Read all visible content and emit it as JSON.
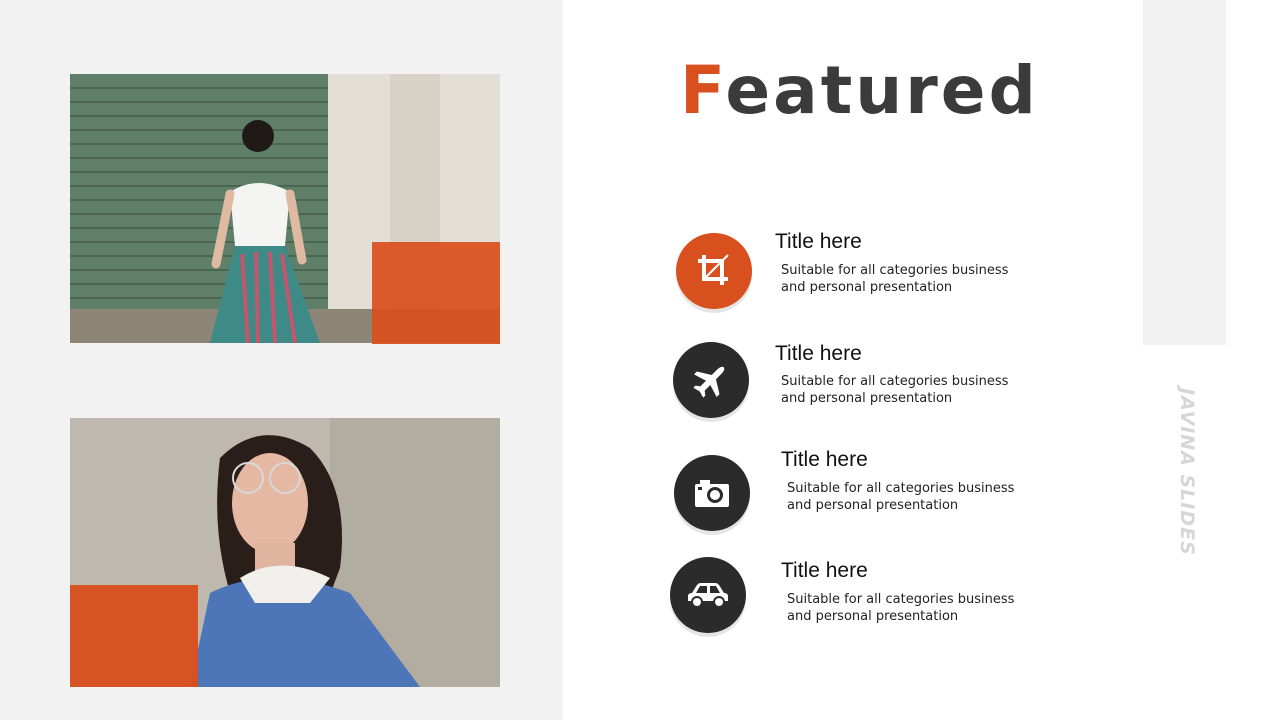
{
  "slide": {
    "heading_first": "F",
    "heading_rest": "eatured",
    "brand": "JAVINA SLIDES",
    "colors": {
      "accent": "#d9501f",
      "dark": "#2b2b2b",
      "panel": "#f2f2f2"
    }
  },
  "features": [
    {
      "icon": "crop-icon",
      "title": "Title here",
      "description": "Suitable for all categories business and personal presentation"
    },
    {
      "icon": "airplane-icon",
      "title": "Title here",
      "description": "Suitable for all categories business and personal presentation"
    },
    {
      "icon": "camera-icon",
      "title": "Title here",
      "description": "Suitable for all categories business and personal presentation"
    },
    {
      "icon": "car-icon",
      "title": "Title here",
      "description": "Suitable for all categories business and personal presentation"
    }
  ]
}
